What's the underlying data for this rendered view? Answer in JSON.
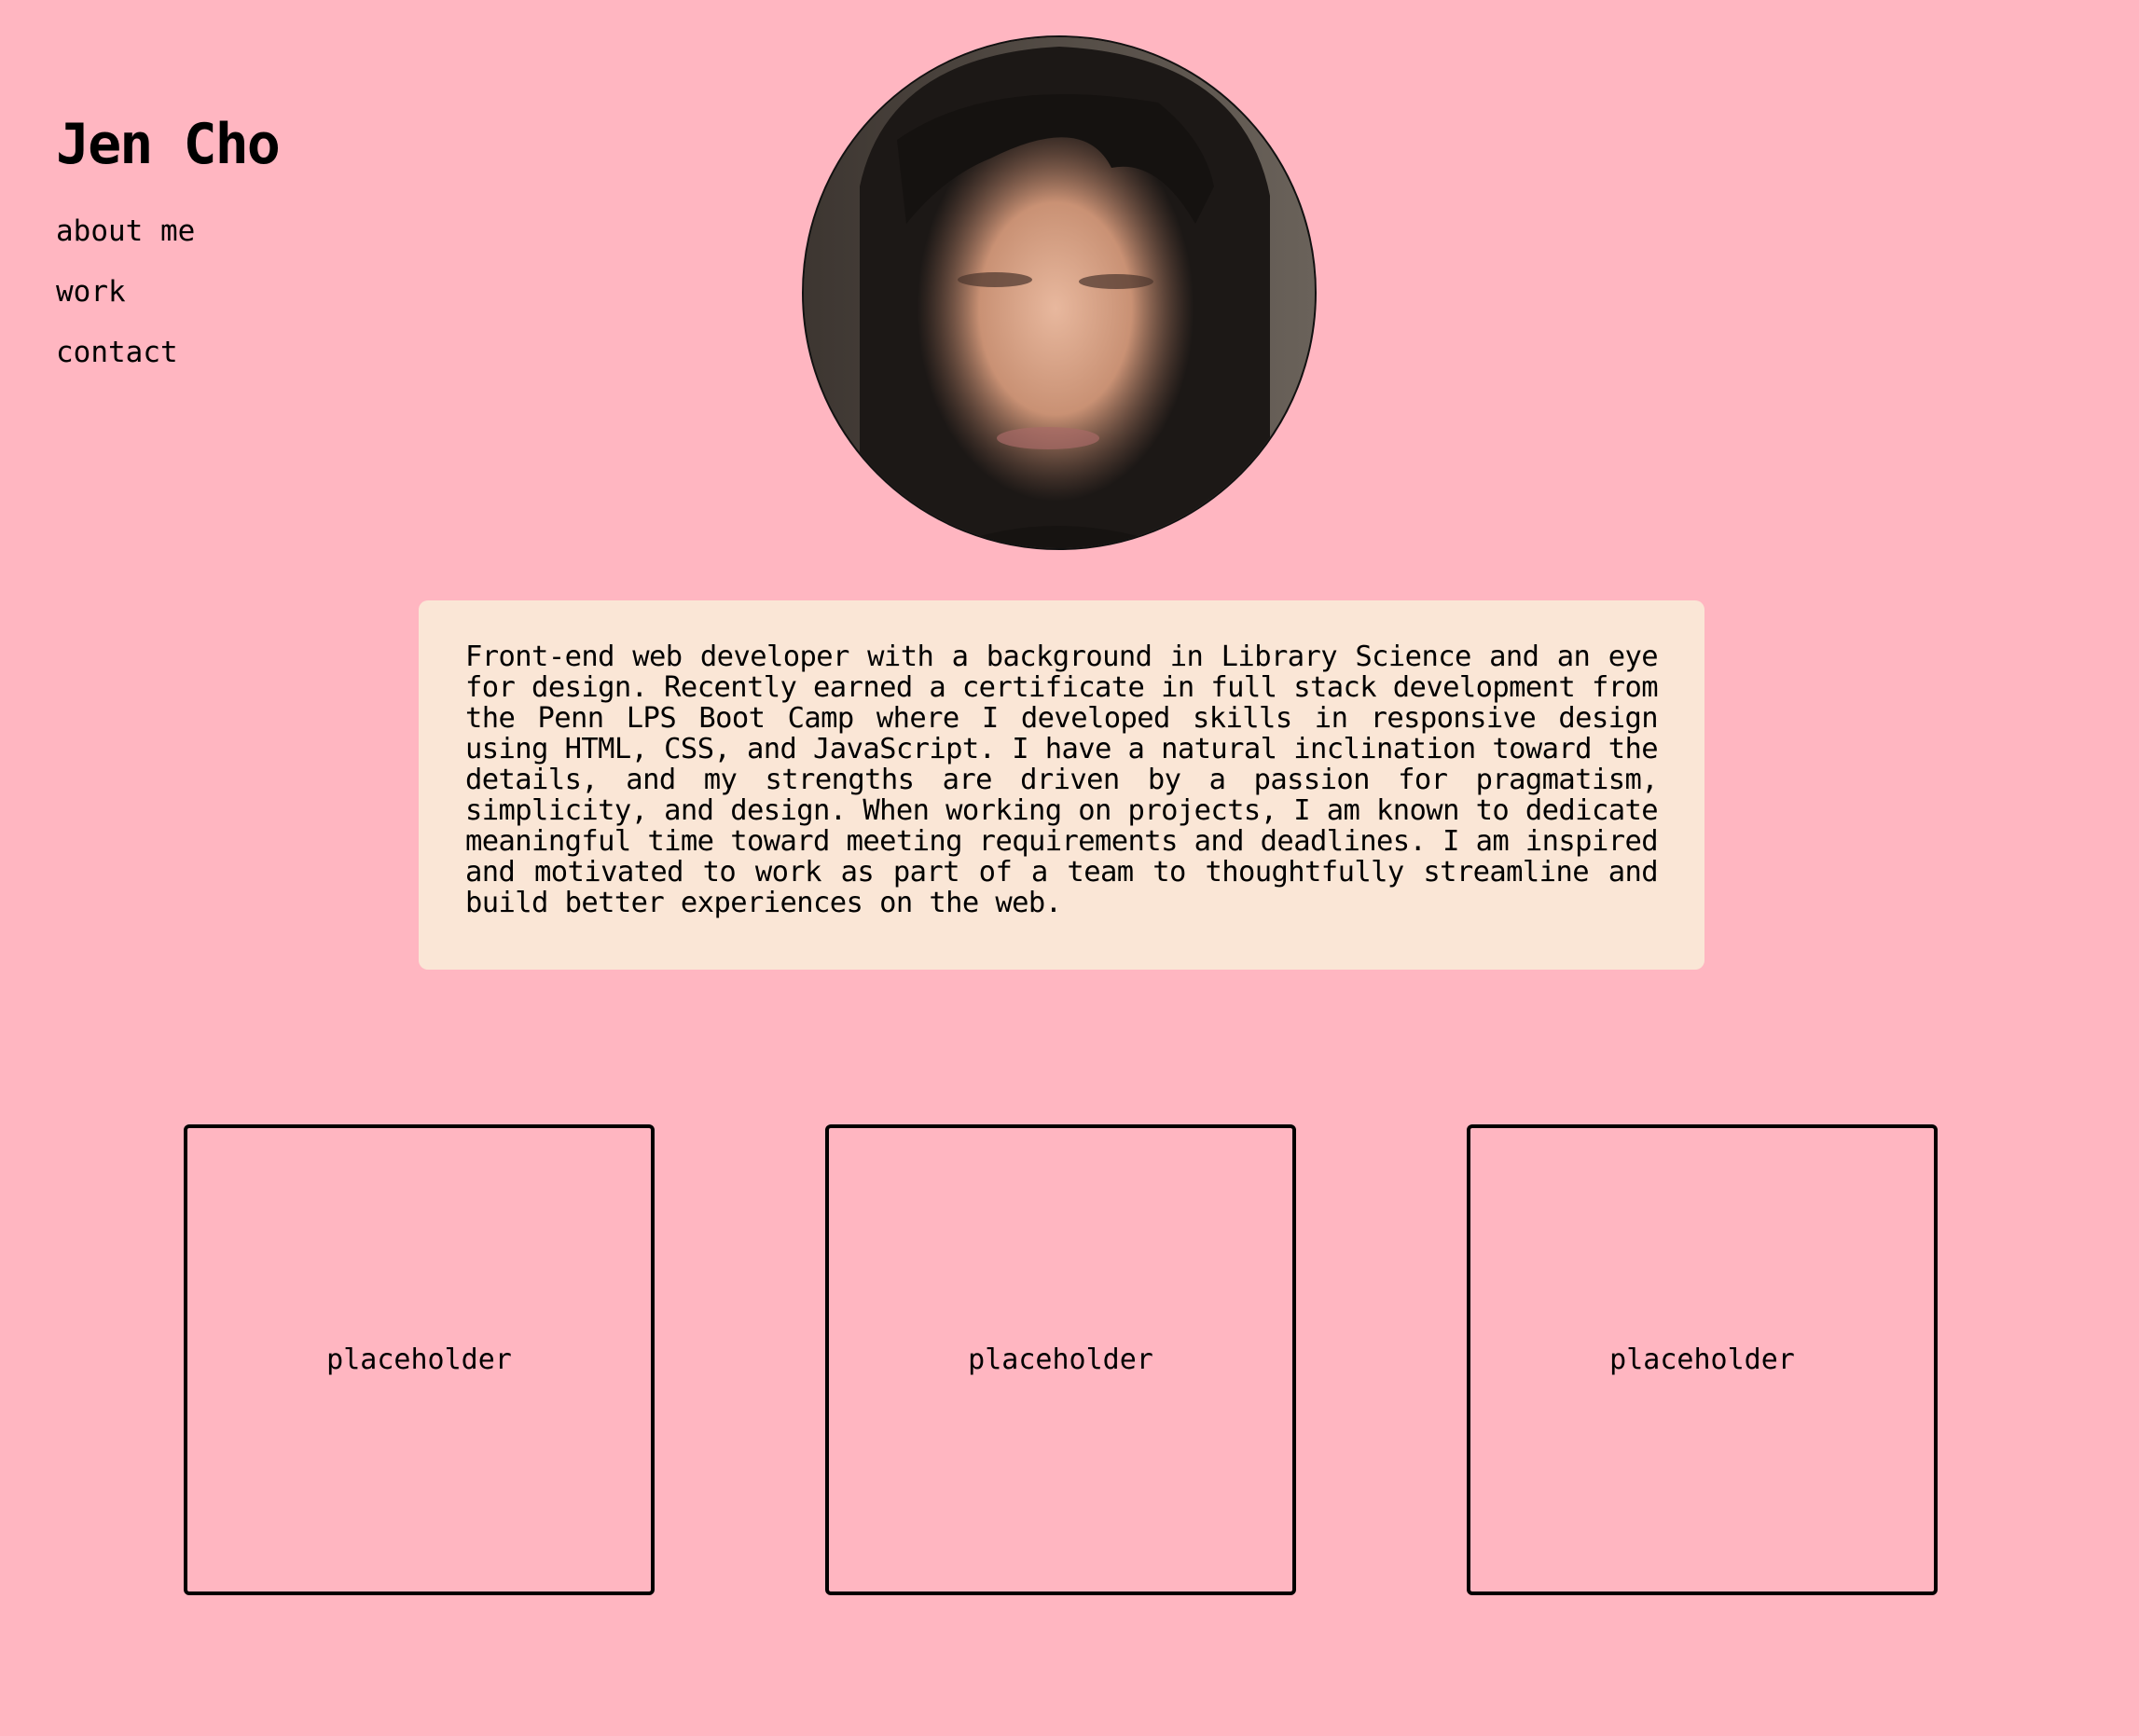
{
  "header": {
    "title": "Jen Cho"
  },
  "nav": {
    "items": [
      {
        "label": "about me"
      },
      {
        "label": "work"
      },
      {
        "label": "contact"
      }
    ]
  },
  "about": {
    "text": "Front-end web developer with a background in Library Science and an eye for design. Recently earned a certificate in full stack development from the Penn LPS Boot Camp where I developed skills in responsive design using HTML, CSS, and JavaScript. I have a natural inclination toward the details, and my strengths are driven by a passion for pragmatism, simplicity, and design. When working on projects, I am known to dedicate meaningful time toward meeting requirements and deadlines. I am inspired and motivated to work as part of a team to thoughtfully streamline and build better experiences on the web."
  },
  "work": {
    "cards": [
      {
        "label": "placeholder"
      },
      {
        "label": "placeholder"
      },
      {
        "label": "placeholder"
      }
    ]
  },
  "colors": {
    "background": "#ffb6c1",
    "card_background": "#fae6d6",
    "text": "#000000"
  }
}
